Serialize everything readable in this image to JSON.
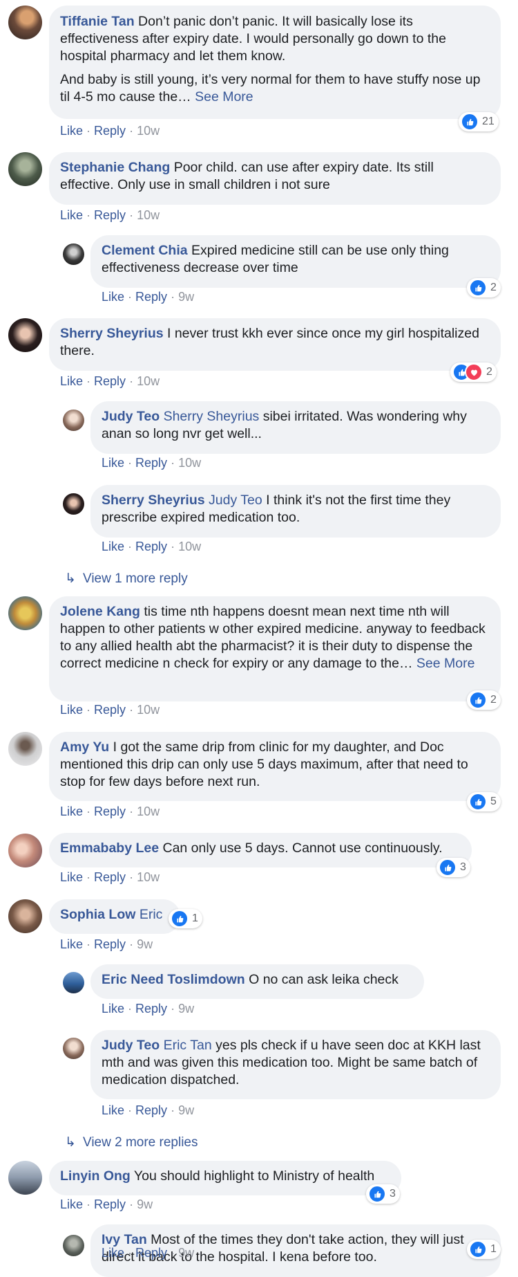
{
  "actions": {
    "like": "Like",
    "reply": "Reply",
    "separator": "·"
  },
  "see_more": "See More",
  "colors": {
    "link": "#385898",
    "bubble": "#f0f2f5",
    "like_blue": "#1877f2",
    "love_red": "#f33e58"
  },
  "comments": {
    "c1": {
      "author": "Tiffanie Tan",
      "text": "Don’t panic don’t panic. It will basically lose its effectiveness after expiry date. I would personally go down to the hospital pharmacy and let them know.",
      "text2": "And baby is still young, it’s very normal for them to have stuffy nose up til 4-5 mo cause the…",
      "time": "10w",
      "reactions": "21"
    },
    "c2": {
      "author": "Stephanie Chang",
      "text": "Poor child. can use after expiry date. Its still effective. Only use in small children i not sure",
      "time": "10w"
    },
    "c2r1": {
      "author": "Clement Chia",
      "text": "Expired medicine still can be use only thing effectiveness decrease over time",
      "time": "9w",
      "reactions": "2"
    },
    "c3": {
      "author": "Sherry Sheyrius",
      "text": "I never trust kkh ever since once my girl hospitalized there.",
      "time": "10w",
      "reactions": "2"
    },
    "c3r1": {
      "author": "Judy Teo",
      "mention": "Sherry Sheyrius",
      "text": "sibei irritated. Was wondering why anan so long nvr get well...",
      "time": "10w"
    },
    "c3r2": {
      "author": "Sherry Sheyrius",
      "mention": "Judy Teo",
      "text": "I think it's not the first time they prescribe expired medication too.",
      "time": "10w"
    },
    "c3_view_more": "View 1 more reply",
    "c4": {
      "author": "Jolene Kang",
      "text": "tis time nth happens doesnt mean next time nth will happen to other patients w other expired medicine. anyway to feedback to any allied health abt the pharmacist? it is their duty to dispense the correct medicine n check for expiry or any damage to the…",
      "time": "10w",
      "reactions": "2"
    },
    "c5": {
      "author": "Amy Yu",
      "text": "I got the same drip from clinic for my daughter, and Doc mentioned this drip can only use 5 days maximum, after that need to stop for few days before next run.",
      "time": "10w",
      "reactions": "5"
    },
    "c6": {
      "author": "Emmababy Lee",
      "text": "Can only use 5 days. Cannot use continuously.",
      "time": "10w",
      "reactions": "3"
    },
    "c7": {
      "author": "Sophia Low",
      "mention": "Eric",
      "time": "9w",
      "reactions": "1"
    },
    "c7r1": {
      "author": "Eric Need Toslimdown",
      "text": "O no can ask leika check",
      "time": "9w"
    },
    "c7r2": {
      "author": "Judy Teo",
      "mention": "Eric Tan",
      "text": "yes pls check if u have seen doc at KKH last mth and was given this medication too. Might be same batch of medication dispatched.",
      "time": "9w"
    },
    "c7_view_more": "View 2 more replies",
    "c8": {
      "author": "Linyin Ong",
      "text": "You should highlight to Ministry of health",
      "time": "9w",
      "reactions": "3"
    },
    "c8r1": {
      "author": "Ivy Tan",
      "text": "Most of the times they don't take action, they will just direct it back to the hospital. I kena before too.",
      "time": "9w",
      "reactions": "1"
    }
  }
}
